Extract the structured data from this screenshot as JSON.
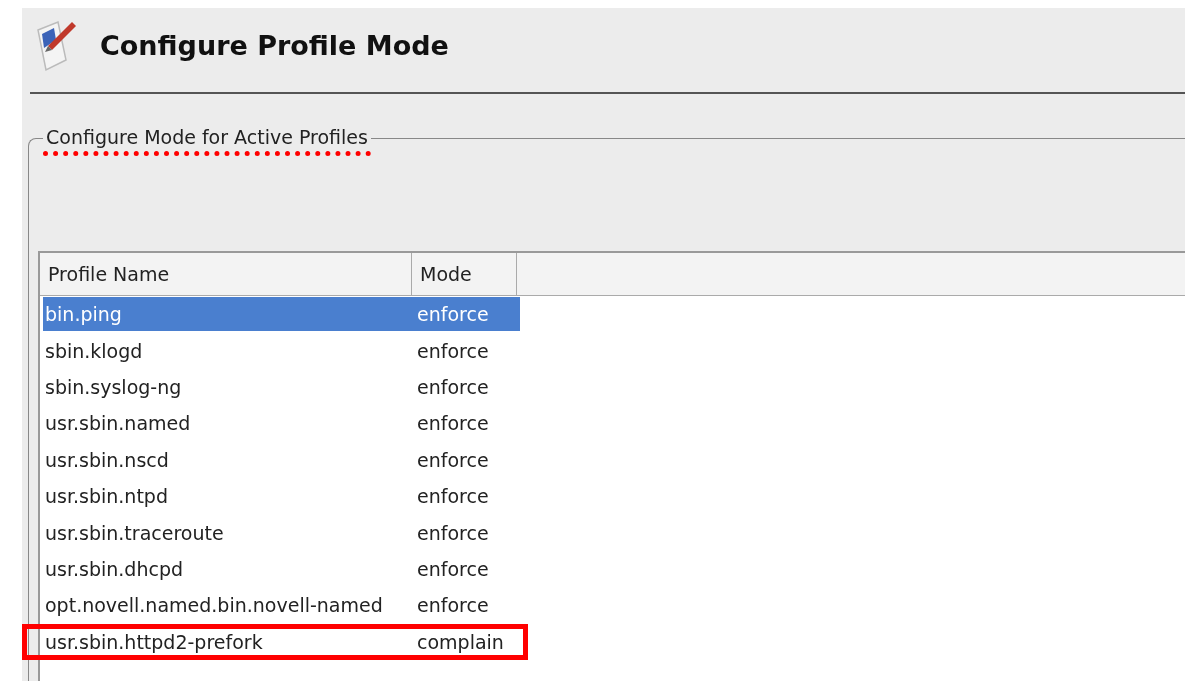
{
  "window": {
    "title": "Configure Profile Mode"
  },
  "group": {
    "title": "Configure Mode for Active Profiles",
    "title_marked": true
  },
  "table": {
    "columns": [
      "Profile Name",
      "Mode"
    ],
    "rows": [
      {
        "name": "bin.ping",
        "mode": "enforce",
        "selected": true,
        "highlighted": false
      },
      {
        "name": "sbin.klogd",
        "mode": "enforce",
        "selected": false,
        "highlighted": false
      },
      {
        "name": "sbin.syslog-ng",
        "mode": "enforce",
        "selected": false,
        "highlighted": false
      },
      {
        "name": "usr.sbin.named",
        "mode": "enforce",
        "selected": false,
        "highlighted": false
      },
      {
        "name": "usr.sbin.nscd",
        "mode": "enforce",
        "selected": false,
        "highlighted": false
      },
      {
        "name": "usr.sbin.ntpd",
        "mode": "enforce",
        "selected": false,
        "highlighted": false
      },
      {
        "name": "usr.sbin.traceroute",
        "mode": "enforce",
        "selected": false,
        "highlighted": false
      },
      {
        "name": "usr.sbin.dhcpd",
        "mode": "enforce",
        "selected": false,
        "highlighted": false
      },
      {
        "name": "opt.novell.named.bin.novell-named",
        "mode": "enforce",
        "selected": false,
        "highlighted": false
      },
      {
        "name": "usr.sbin.httpd2-prefork",
        "mode": "complain",
        "selected": false,
        "highlighted": true
      }
    ]
  }
}
